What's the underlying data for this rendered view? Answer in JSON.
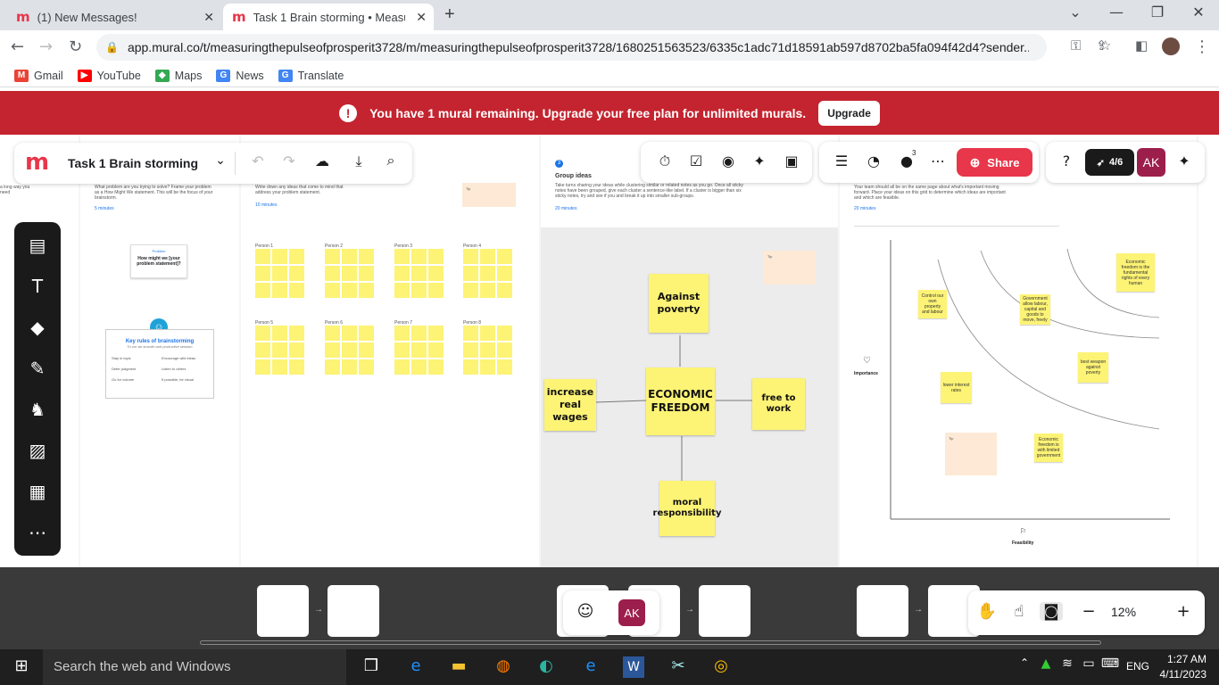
{
  "browser": {
    "tabs": [
      {
        "title": "(1) New Messages!",
        "active": false
      },
      {
        "title": "Task 1 Brain storming • Measurin",
        "active": true
      }
    ],
    "new_tab": "+",
    "url": "app.mural.co/t/measuringthepulseofprosperit3728/m/measuringthepulseofprosperit3728/1680251563523/6335c1adc71d18591ab597d8702ba5fa094f42d4?sender...",
    "bookmarks": [
      "Gmail",
      "YouTube",
      "Maps",
      "News",
      "Translate"
    ]
  },
  "banner": {
    "message": "You have 1 mural remaining. Upgrade your free plan for unlimited murals.",
    "button": "Upgrade"
  },
  "toolbar": {
    "title": "Task 1 Brain storming",
    "share": "Share",
    "progress": "4/6",
    "avatar": "AK",
    "member_count": "3"
  },
  "panel1": {
    "desc": "What problem are you trying to solve? Frame your problem as a How Might We statement. This will be the focus of your brainstorm.",
    "time": "5 minutes",
    "card_title": "Problem",
    "card_text": "How might we [your problem statement]?",
    "rules_title": "Key rules of brainstorming",
    "rules_sub": "To run an smooth and productive session",
    "rules": [
      "Stay in topic",
      "Encourage wild ideas",
      "Defer judgment",
      "Listen to others",
      "Go for volume",
      "If possible, be visual"
    ]
  },
  "panel2": {
    "desc": "Write down any ideas that come to mind that address your problem statement.",
    "time": "10 minutes",
    "persons": [
      "Person 1",
      "Person 2",
      "Person 3",
      "Person 4",
      "Person 5",
      "Person 6",
      "Person 7",
      "Person 8"
    ]
  },
  "panel3": {
    "step": "3",
    "title": "Group ideas",
    "desc": "Take turns sharing your ideas while clustering similar or related notes as you go. Once all sticky notes have been grouped, give each cluster a sentence-like label. If a cluster is bigger than six sticky notes, try and see if you and break it up into smaller sub-groups.",
    "time": "20 minutes",
    "center": "ECONOMIC FREEDOM",
    "ideas": [
      "Against poverty",
      "increase real wages",
      "free to work",
      "moral responsibility"
    ]
  },
  "panel4": {
    "desc": "Your team should all be on the same page about what's important moving forward. Place your ideas on this grid to determine which ideas are important and which are feasible.",
    "time": "20 minutes",
    "y_label": "Importance",
    "x_label": "Feasibility",
    "notes": [
      "Control our own property and labour",
      "Government allow labour, capital and goods to move, freely",
      "Economic freedom is the fundamental rights of every human",
      "best weapon against poverty",
      "lower interest rates",
      "Economic freedom is with limited government"
    ]
  },
  "bottom": {
    "zoom": "12%",
    "avatar": "AK"
  },
  "taskbar": {
    "search": "Search the web and Windows",
    "lang": "ENG",
    "time": "1:27 AM",
    "date": "4/11/2023"
  }
}
